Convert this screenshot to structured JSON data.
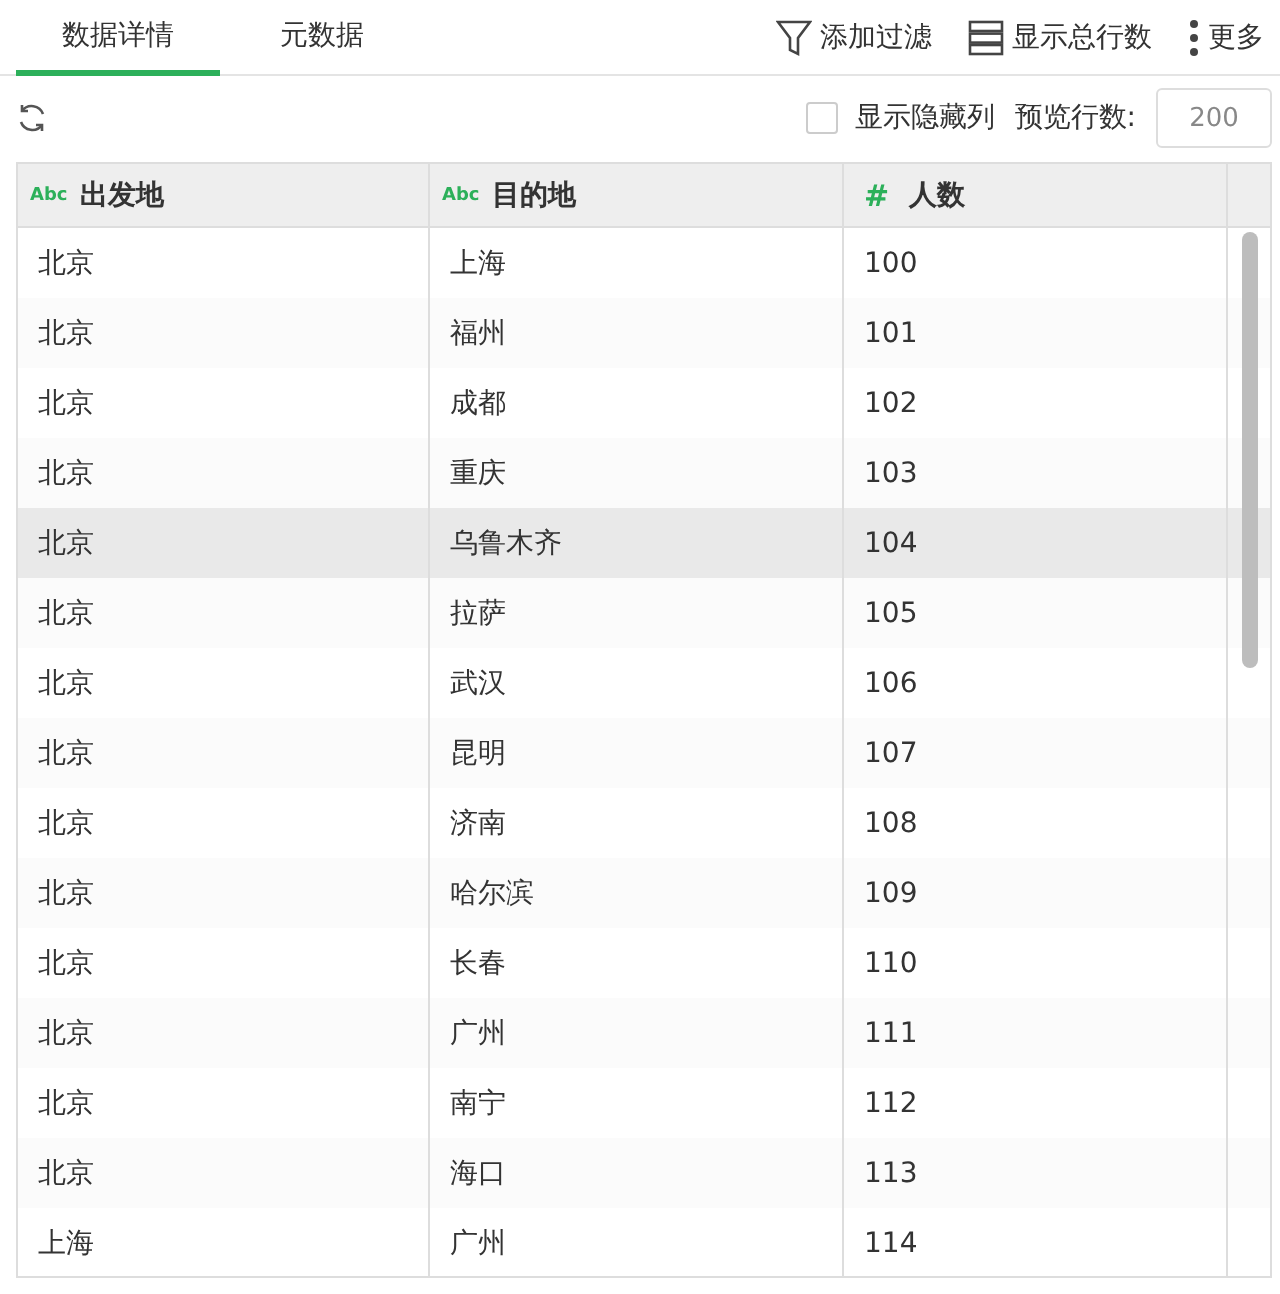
{
  "tabs": [
    {
      "label": "数据详情",
      "selected": true
    },
    {
      "label": "元数据",
      "selected": false
    }
  ],
  "actions": [
    {
      "kind": "filter",
      "label": "添加过滤"
    },
    {
      "kind": "rows",
      "label": "显示总行数"
    },
    {
      "kind": "more",
      "label": "更多"
    }
  ],
  "toolbar": {
    "show_hidden": {
      "label": "显示隐藏列",
      "checked": false
    },
    "preview_label": "预览行数:",
    "preview_value": "200"
  },
  "table": {
    "columns": [
      {
        "type_icon": "Abc",
        "label": "出发地"
      },
      {
        "type_icon": "Abc",
        "label": "目的地"
      },
      {
        "type_icon": "#",
        "label": "人数"
      }
    ],
    "rows": [
      {
        "cells": [
          "北京",
          "上海",
          "100"
        ],
        "selected": false
      },
      {
        "cells": [
          "北京",
          "福州",
          "101"
        ],
        "selected": false
      },
      {
        "cells": [
          "北京",
          "成都",
          "102"
        ],
        "selected": false
      },
      {
        "cells": [
          "北京",
          "重庆",
          "103"
        ],
        "selected": false
      },
      {
        "cells": [
          "北京",
          "乌鲁木齐",
          "104"
        ],
        "selected": true
      },
      {
        "cells": [
          "北京",
          "拉萨",
          "105"
        ],
        "selected": false
      },
      {
        "cells": [
          "北京",
          "武汉",
          "106"
        ],
        "selected": false
      },
      {
        "cells": [
          "北京",
          "昆明",
          "107"
        ],
        "selected": false
      },
      {
        "cells": [
          "北京",
          "济南",
          "108"
        ],
        "selected": false
      },
      {
        "cells": [
          "北京",
          "哈尔滨",
          "109"
        ],
        "selected": false
      },
      {
        "cells": [
          "北京",
          "长春",
          "110"
        ],
        "selected": false
      },
      {
        "cells": [
          "北京",
          "广州",
          "111"
        ],
        "selected": false
      },
      {
        "cells": [
          "北京",
          "南宁",
          "112"
        ],
        "selected": false
      },
      {
        "cells": [
          "北京",
          "海口",
          "113"
        ],
        "selected": false
      },
      {
        "cells": [
          "上海",
          "广州",
          "114"
        ],
        "selected": false
      }
    ]
  }
}
